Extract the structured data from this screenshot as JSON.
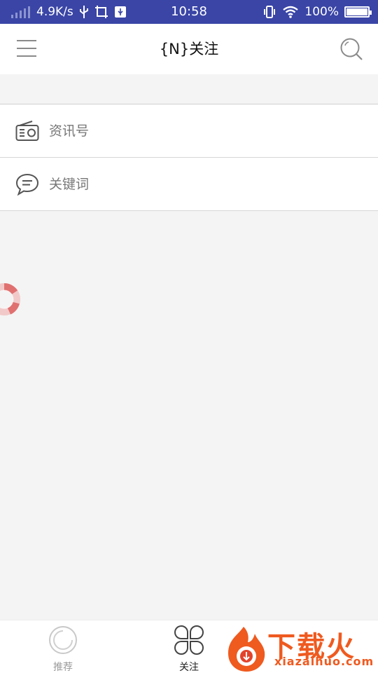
{
  "status_bar": {
    "net_speed": "4.9K/s",
    "time": "10:58",
    "battery": "100%"
  },
  "header": {
    "title": "{N}关注",
    "menu_icon": "hamburger-menu-icon",
    "search_icon": "search-icon"
  },
  "subscriptions": [
    {
      "label": "资讯号",
      "icon": "radio-icon"
    },
    {
      "label": "关键词",
      "icon": "speech-bubble-icon"
    }
  ],
  "tabs": [
    {
      "label": "推荐",
      "icon": "circle-icon",
      "active": false
    },
    {
      "label": "关注",
      "icon": "four-leaf-icon",
      "active": true
    }
  ],
  "watermark": {
    "title": "下载火",
    "url": "xiazaihuo.com"
  },
  "colors": {
    "status_bar": "#3a45a6",
    "accent": "#ef5a1f"
  }
}
